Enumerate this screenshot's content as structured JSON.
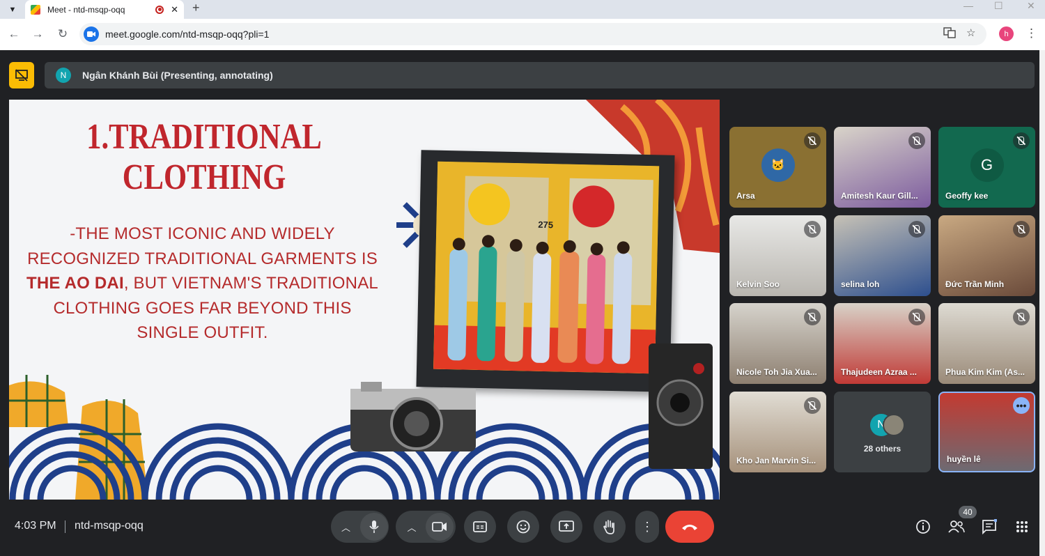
{
  "browser": {
    "tab_title": "Meet - ntd-msqp-oqq",
    "url": "meet.google.com/ntd-msqp-oqq?pli=1",
    "profile_initial": "h"
  },
  "presenter_bar": {
    "avatar_initial": "N",
    "text": "Ngân Khánh Bùi (Presenting, annotating)"
  },
  "slide": {
    "heading_line1": "1.TRADITIONAL",
    "heading_line2": "CLOTHING",
    "body_part1": "-THE MOST ICONIC AND WIDELY RECOGNIZED TRADITIONAL GARMENTS IS",
    "body_bold": "THE AO DAI",
    "body_part2": ", BUT VIETNAM'S TRADITIONAL CLOTHING GOES FAR BEYOND THIS SINGLE OUTFIT.",
    "photo_sign": "275",
    "colors": {
      "heading": "#c0262d",
      "body": "#b52b2c",
      "wave": "#1f3f8a",
      "accent": "#c8392b"
    }
  },
  "participants": [
    {
      "name": "Arsa",
      "muted": true
    },
    {
      "name": "Amitesh Kaur Gill...",
      "muted": true
    },
    {
      "name": "Geoffy kee",
      "muted": true,
      "avatar_initial": "G"
    },
    {
      "name": "Kelvin Soo",
      "muted": true
    },
    {
      "name": "selina loh",
      "muted": true
    },
    {
      "name": "Đức Trần Minh",
      "muted": true
    },
    {
      "name": "Nicole Toh Jia Xua...",
      "muted": true
    },
    {
      "name": "Thajudeen Azraa ...",
      "muted": true
    },
    {
      "name": "Phua Kim Kim (As...",
      "muted": true
    },
    {
      "name": "Kho Jan Marvin Si...",
      "muted": true
    },
    {
      "name": "28 others",
      "avatar_initial": "N"
    },
    {
      "name": "huyền lê",
      "muted": false
    }
  ],
  "bottom": {
    "time": "4:03 PM",
    "meeting_code": "ntd-msqp-oqq",
    "people_count": "40"
  },
  "icons": [
    "present-lock-icon",
    "mic-icon",
    "camera-icon",
    "captions-icon",
    "emoji-icon",
    "present-screen-icon",
    "raise-hand-icon",
    "more-options-icon",
    "end-call-icon",
    "info-icon",
    "people-icon",
    "chat-icon",
    "activities-icon"
  ]
}
